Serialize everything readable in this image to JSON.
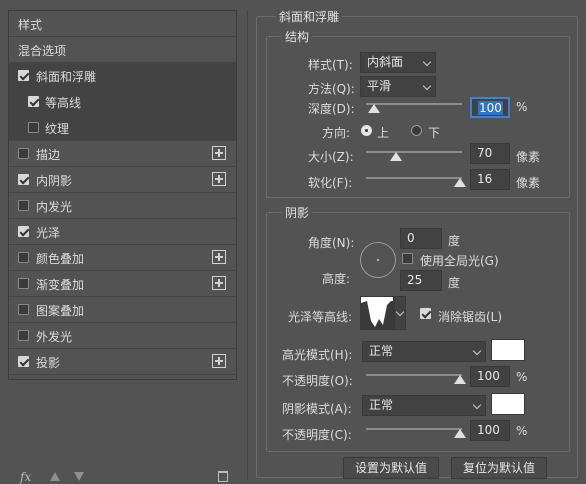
{
  "left_panel": {
    "items": [
      {
        "label": "样式",
        "checkbox": null,
        "plus": false
      },
      {
        "label": "混合选项",
        "checkbox": null,
        "plus": false
      },
      {
        "label": "斜面和浮雕",
        "checkbox": true,
        "plus": false,
        "selected": true
      },
      {
        "label": "等高线",
        "checkbox": true,
        "plus": false,
        "indent": true
      },
      {
        "label": "纹理",
        "checkbox": false,
        "plus": false,
        "indent": true
      },
      {
        "label": "描边",
        "checkbox": false,
        "plus": true
      },
      {
        "label": "内阴影",
        "checkbox": true,
        "plus": true
      },
      {
        "label": "内发光",
        "checkbox": false,
        "plus": false
      },
      {
        "label": "光泽",
        "checkbox": true,
        "plus": false
      },
      {
        "label": "颜色叠加",
        "checkbox": false,
        "plus": true
      },
      {
        "label": "渐变叠加",
        "checkbox": false,
        "plus": true
      },
      {
        "label": "图案叠加",
        "checkbox": false,
        "plus": false
      },
      {
        "label": "外发光",
        "checkbox": false,
        "plus": false
      },
      {
        "label": "投影",
        "checkbox": true,
        "plus": true
      }
    ],
    "footer": {
      "fx": "fx"
    }
  },
  "bevel": {
    "title": "斜面和浮雕",
    "structure": {
      "title": "结构",
      "style_label": "样式(T):",
      "style_value": "内斜面",
      "technique_label": "方法(Q):",
      "technique_value": "平滑",
      "depth_label": "深度(D):",
      "depth_value": "100",
      "depth_unit": "%",
      "depth_level": 0.1,
      "direction_label": "方向:",
      "direction_up": "上",
      "direction_down": "下",
      "size_label": "大小(Z):",
      "size_value": "70",
      "size_unit": "像素",
      "size_level": 0.3,
      "soften_label": "软化(F):",
      "soften_value": "16",
      "soften_unit": "像素",
      "soften_level": 0.95
    },
    "shading": {
      "title": "阴影",
      "angle_label": "角度(N):",
      "angle_value": "0",
      "angle_unit": "度",
      "global_light_label": "使用全局光(G)",
      "altitude_label": "高度:",
      "altitude_value": "25",
      "altitude_unit": "度",
      "gloss_label": "光泽等高线:",
      "antialias_label": "消除锯齿(L)",
      "highlight_mode_label": "高光模式(H):",
      "highlight_mode_value": "正常",
      "highlight_color": "#ffffff",
      "highlight_opacity_label": "不透明度(O):",
      "highlight_opacity_value": "100",
      "highlight_opacity_unit": "%",
      "shadow_mode_label": "阴影模式(A):",
      "shadow_mode_value": "正常",
      "shadow_color": "#ffffff",
      "shadow_opacity_label": "不透明度(C):",
      "shadow_opacity_value": "100",
      "shadow_opacity_unit": "%"
    }
  },
  "buttons": {
    "make_default": "设置为默认值",
    "reset_default": "复位为默认值"
  }
}
